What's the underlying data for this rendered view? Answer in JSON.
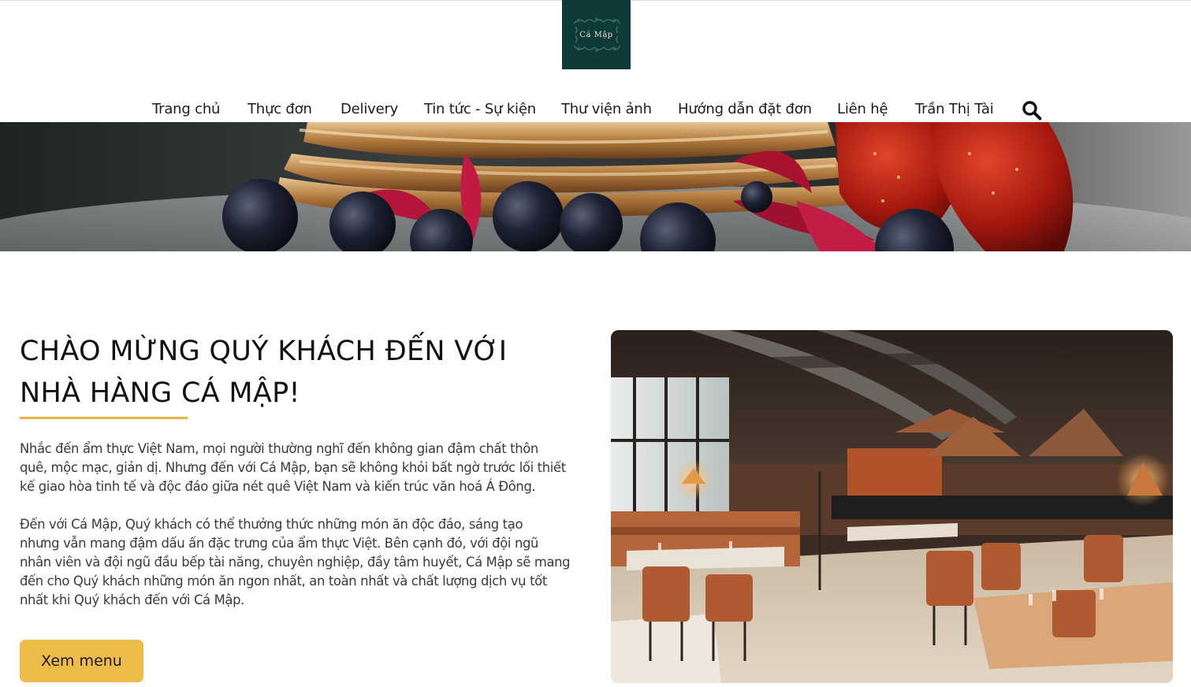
{
  "brand": {
    "logo_text": "Cá Mập",
    "logo_bg": "#0e3a3a"
  },
  "nav": {
    "items": [
      {
        "label": "Trang chủ"
      },
      {
        "label": "Thực đơn"
      },
      {
        "label": "Delivery"
      },
      {
        "label": "Tin tức - Sự kiện"
      },
      {
        "label": "Thư viện ảnh"
      },
      {
        "label": "Hướng dẫn đặt đơn"
      },
      {
        "label": "Liên hệ"
      },
      {
        "label": "Trần Thị Tài"
      }
    ],
    "search_icon": "search-icon"
  },
  "hero": {
    "heading_line1": "CHÀO MỪNG QUÝ KHÁCH ĐẾN VỚI",
    "heading_line2": "NHÀ HÀNG CÁ MẬP!",
    "paragraph1_lines": [
      "Nhắc đến ẩm thực Việt Nam, mọi người thường nghĩ đến không gian đậm chất thôn",
      "quê, mộc mạc, giản dị. Nhưng đến với Cá Mập, bạn sẽ không khỏi bất ngờ trước lối thiết",
      "kế giao hòa tinh tế và độc đáo giữa nét quê Việt Nam và kiến trúc văn hoá Á Đông."
    ],
    "paragraph2_lines": [
      "Đến với Cá Mập, Quý khách có thể thưởng thức những món ăn độc đáo, sáng tạo",
      "nhưng vẫn mang đậm dấu ấn đặc trưng của ẩm thực Việt. Bên cạnh đó, với đội ngũ",
      "nhân viên và đội ngũ đầu bếp tài năng, chuyên nghiệp, đầy tâm huyết, Cá Mập sẽ mang",
      "đến cho Quý khách những món ăn ngon nhất, an toàn nhất và chất lượng dịch vụ tốt",
      "nhất khi Quý khách đến với Cá Mập."
    ],
    "cta_label": "Xem menu"
  },
  "colors": {
    "accent": "#efbb4b",
    "underline": "#e8b443",
    "text": "#3a3a3a"
  }
}
